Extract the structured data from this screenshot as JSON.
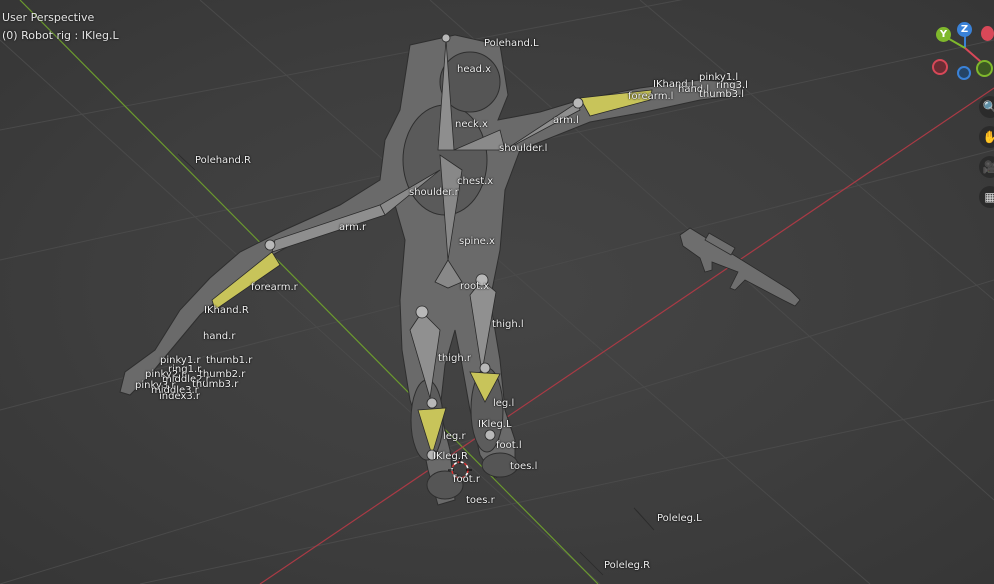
{
  "viewport": {
    "perspective_label": "User Perspective",
    "object_label": "(0) Robot rig : IKleg.L"
  },
  "gizmo": {
    "y": "Y",
    "z": "Z"
  },
  "colors": {
    "x_axis": "#a93a45",
    "y_axis": "#6b9a2e",
    "bone": "#8e8e8e",
    "bone_selected": "#c8c45a",
    "gizmo_x": "#d84858",
    "gizmo_y": "#7fb82c",
    "gizmo_z": "#3a82d8"
  },
  "nav_icons": [
    "zoom-icon",
    "hand-icon",
    "camera-icon",
    "grid-icon"
  ],
  "bones": {
    "polehand_l": "Polehand.L",
    "head_x": "head.x",
    "neck_x": "neck.x",
    "arm_l": "arm.l",
    "forearm_l": "forearm.l",
    "ikhand_l": "IKhand.L",
    "hand_l": "hand.l",
    "pinky_l": "pinky1.l",
    "ring_l": "ring3.l",
    "thumb_l": "thumb3.l",
    "shoulder_l": "shoulder.l",
    "polehand_r": "Polehand.R",
    "chest_x": "chest.x",
    "shoulder_r": "shoulder.r",
    "arm_r": "arm.r",
    "spine_x": "spine.x",
    "forearm_r": "forearm.r",
    "root_x": "root.x",
    "ikhand_r": "IKhand.R",
    "thigh_l": "thigh.l",
    "hand_r": "hand.r",
    "pinky1_r": "pinky1.r",
    "thumb1_r": "thumb1.r",
    "ring1_r": "ring1.r",
    "thumb2_r": "thumb2.r",
    "pinky2_r": "pinky2.r",
    "middle2_r": "middle2.r",
    "thumb3_r": "thumb3.r",
    "pinky3_r": "pinky3.r",
    "middle3_r": "middle3.r",
    "index3_r": "index3.r",
    "thigh_r": "thigh.r",
    "leg_l": "leg.l",
    "ikleg_l": "IKleg.L",
    "leg_r": "leg.r",
    "foot_l": "foot.l",
    "ikleg_r": "IKleg.R",
    "toes_l": "toes.l",
    "foot_r": "foot.r",
    "toes_r": "toes.r",
    "poleleg_l": "Poleleg.L",
    "poleleg_r": "Poleleg.R"
  }
}
